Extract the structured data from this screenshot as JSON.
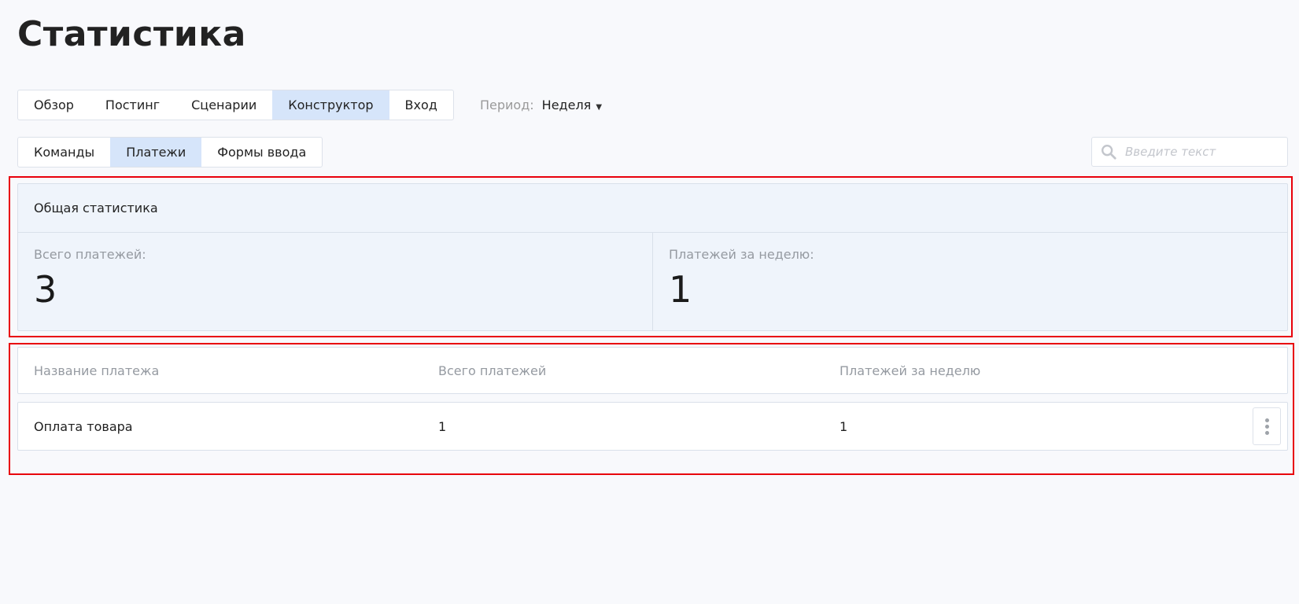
{
  "page": {
    "title": "Статистика"
  },
  "main_tabs": [
    {
      "label": "Обзор",
      "active": false
    },
    {
      "label": "Постинг",
      "active": false
    },
    {
      "label": "Сценарии",
      "active": false
    },
    {
      "label": "Конструктор",
      "active": true
    },
    {
      "label": "Вход",
      "active": false
    }
  ],
  "period": {
    "label": "Период:",
    "value": "Неделя",
    "icon": "caret-down-icon"
  },
  "sub_tabs": [
    {
      "label": "Команды",
      "active": false
    },
    {
      "label": "Платежи",
      "active": true
    },
    {
      "label": "Формы ввода",
      "active": false
    }
  ],
  "search": {
    "placeholder": "Введите текст",
    "value": "",
    "icon": "search-icon"
  },
  "stats": {
    "header": "Общая статистика",
    "total_label": "Всего платежей:",
    "total_value": "3",
    "week_label": "Платежей за неделю:",
    "week_value": "1"
  },
  "table": {
    "headers": [
      "Название платежа",
      "Всего платежей",
      "Платежей за неделю"
    ],
    "rows": [
      {
        "name": "Оплата товара",
        "total": "1",
        "week": "1"
      }
    ]
  },
  "colors": {
    "active_tab": "#d6e5fa",
    "highlight": "#e8000b",
    "panel_bg": "#eff4fb",
    "page_bg": "#f8f9fc"
  }
}
